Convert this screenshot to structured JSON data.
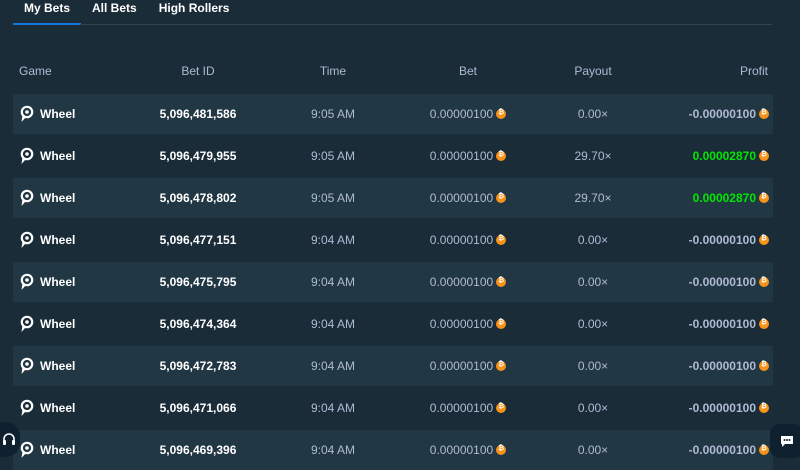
{
  "tabs": [
    "My Bets",
    "All Bets",
    "High Rollers"
  ],
  "headers": {
    "game": "Game",
    "bet_id": "Bet ID",
    "time": "Time",
    "bet": "Bet",
    "payout": "Payout",
    "profit": "Profit"
  },
  "rows": [
    {
      "game": "Wheel",
      "bet_id": "5,096,481,586",
      "time": "9:05 AM",
      "bet": "0.00000100",
      "payout": "0.00×",
      "profit": "-0.00000100",
      "profit_sign": "neg"
    },
    {
      "game": "Wheel",
      "bet_id": "5,096,479,955",
      "time": "9:05 AM",
      "bet": "0.00000100",
      "payout": "29.70×",
      "profit": "0.00002870",
      "profit_sign": "pos"
    },
    {
      "game": "Wheel",
      "bet_id": "5,096,478,802",
      "time": "9:05 AM",
      "bet": "0.00000100",
      "payout": "29.70×",
      "profit": "0.00002870",
      "profit_sign": "pos"
    },
    {
      "game": "Wheel",
      "bet_id": "5,096,477,151",
      "time": "9:04 AM",
      "bet": "0.00000100",
      "payout": "0.00×",
      "profit": "-0.00000100",
      "profit_sign": "neg"
    },
    {
      "game": "Wheel",
      "bet_id": "5,096,475,795",
      "time": "9:04 AM",
      "bet": "0.00000100",
      "payout": "0.00×",
      "profit": "-0.00000100",
      "profit_sign": "neg"
    },
    {
      "game": "Wheel",
      "bet_id": "5,096,474,364",
      "time": "9:04 AM",
      "bet": "0.00000100",
      "payout": "0.00×",
      "profit": "-0.00000100",
      "profit_sign": "neg"
    },
    {
      "game": "Wheel",
      "bet_id": "5,096,472,783",
      "time": "9:04 AM",
      "bet": "0.00000100",
      "payout": "0.00×",
      "profit": "-0.00000100",
      "profit_sign": "neg"
    },
    {
      "game": "Wheel",
      "bet_id": "5,096,471,066",
      "time": "9:04 AM",
      "bet": "0.00000100",
      "payout": "0.00×",
      "profit": "-0.00000100",
      "profit_sign": "neg"
    },
    {
      "game": "Wheel",
      "bet_id": "5,096,469,396",
      "time": "9:04 AM",
      "bet": "0.00000100",
      "payout": "0.00×",
      "profit": "-0.00000100",
      "profit_sign": "neg"
    }
  ],
  "icons": {
    "game": "wheel-pin-icon",
    "currency": "bitcoin-icon",
    "support": "headset-icon",
    "chat": "chat-bubble-icon"
  },
  "colors": {
    "background": "#1a2c38",
    "row_alt": "#213743",
    "tab_indicator": "#1475e1",
    "profit_positive": "#00e701",
    "bitcoin": "#f7931a"
  }
}
